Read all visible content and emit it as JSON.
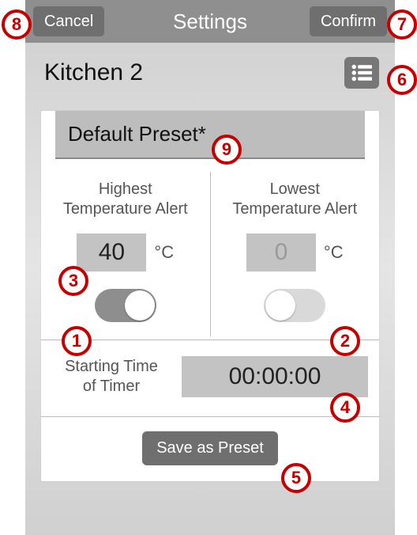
{
  "nav": {
    "title": "Settings",
    "cancel": "Cancel",
    "confirm": "Confirm"
  },
  "header": {
    "title": "Kitchen 2"
  },
  "preset": {
    "name": "Default Preset*"
  },
  "high": {
    "label1": "Highest",
    "label2": "Temperature Alert",
    "value": "40",
    "unit": "°C",
    "enabled": true
  },
  "low": {
    "label1": "Lowest",
    "label2": "Temperature Alert",
    "value": "0",
    "unit": "°C",
    "enabled": false
  },
  "timer": {
    "label1": "Starting Time",
    "label2": "of Timer",
    "value": "00:00:00"
  },
  "save": {
    "label": "Save as Preset"
  },
  "callouts": {
    "c1": "1",
    "c2": "2",
    "c3": "3",
    "c4": "4",
    "c5": "5",
    "c6": "6",
    "c7": "7",
    "c8": "8",
    "c9": "9"
  }
}
